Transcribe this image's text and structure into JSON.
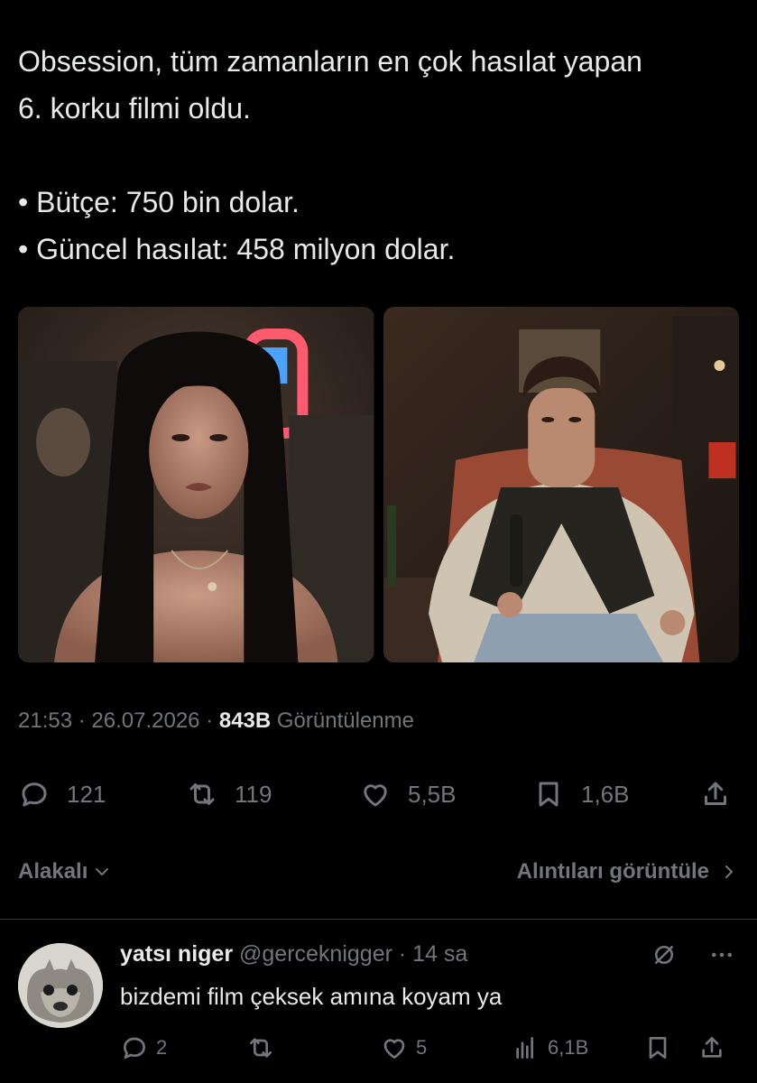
{
  "tweet": {
    "line1": "Obsession, tüm zamanların en çok hasılat yapan",
    "line2": "6. korku filmi oldu.",
    "bullet1": "• Bütçe: 750 bin dolar.",
    "bullet2": "• Güncel hasılat: 458 milyon dolar.",
    "time": "21:53",
    "sep1": " · ",
    "date": "26.07.2026",
    "sep2": " · ",
    "views": "843B",
    "views_label": " Görüntülenme",
    "replies": "121",
    "reposts": "119",
    "likes": "5,5B",
    "bookmarks": "1,6B"
  },
  "sort": {
    "left_label": "Alakalı",
    "right_label": "Alıntıları görüntüle"
  },
  "reply": {
    "name": "yatsı niger",
    "handle": " @gerceknigger",
    "time": " · 14 sa",
    "text": "bizdemi film çeksek amına koyam ya",
    "replies": "2",
    "reposts": "",
    "likes": "5",
    "views": "6,1B"
  },
  "icons": {
    "reply": "speech-bubble-icon",
    "repost": "repost-arrows-icon",
    "like": "heart-icon",
    "bookmark": "bookmark-icon",
    "share": "share-upload-icon",
    "views": "bar-chart-icon",
    "grok": "slashed-circle-icon",
    "more": "more-dots-icon"
  },
  "colors": {
    "background": "#000000",
    "text": "#e7e9ea",
    "muted": "#71767b",
    "divider": "#2f3336"
  }
}
